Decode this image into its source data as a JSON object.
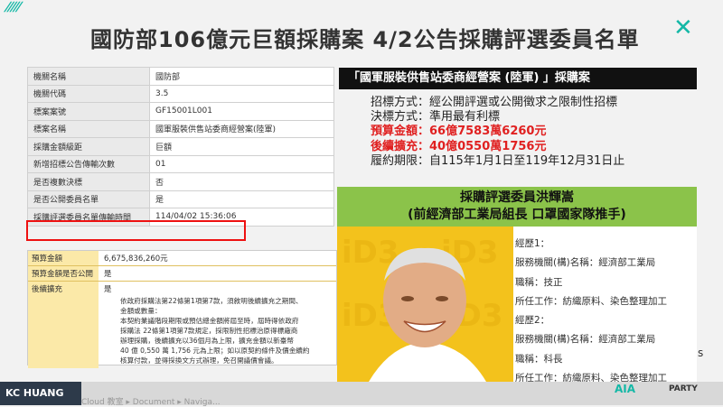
{
  "title": "國防部106億元巨額採購案  4/2公告採購評選委員名單",
  "left_table": [
    {
      "label": "機關名稱",
      "value": "國防部"
    },
    {
      "label": "機關代碼",
      "value": "3.5"
    },
    {
      "label": "標案案號",
      "value": "GF15001L001"
    },
    {
      "label": "標案名稱",
      "value": "國軍服裝供售站委商經營案(陸軍)"
    },
    {
      "label": "採購金額級距",
      "value": "巨額"
    },
    {
      "label": "新增招標公告傳輸次數",
      "value": "01"
    },
    {
      "label": "是否複數決標",
      "value": "否"
    },
    {
      "label": "是否公開委員名單",
      "value": "是"
    },
    {
      "label": "採購評選委員名單傳輸時間",
      "value": "114/04/02 15:36:06"
    }
  ],
  "budget": {
    "rows": [
      {
        "label": "預算金額",
        "value": "6,675,836,260元"
      },
      {
        "label": "預算金額是否公開",
        "value": "是"
      },
      {
        "label": "後續擴充",
        "value": "是"
      }
    ],
    "note": "依政府採購法第22條第1項第7款，須敘明後續擴充之期間、\n金額或數量：\n本契約業議階段期限或預估總金額將屆至時，屆時得依政府\n採購法 22條第1項第7款規定，採限制性招標治原得標廠商\n辦理採購，後續擴充以36個月為上限，擴充金額以新臺幣\n40 億 0,550 萬 1,756 元為上限；如以原契約條件及價金續約\n核算付款，並得採換文方式辦理，免召開議價會議。"
  },
  "right_header": "「國軍服裝供售站委商經營案 (陸軍) 」採購案",
  "info": {
    "method": "招標方式：經公開評選或公開徵求之限制性招標",
    "award": "決標方式：準用最有利標",
    "budget": "預算金額：66億7583萬6260元",
    "expansion": "後續擴充：40億0550萬1756元",
    "period": "履約期限：自115年1月1日至119年12月31日止"
  },
  "committee": {
    "line1": "採購評選委員洪輝嵩",
    "line2": "(前經濟部工業局組長 口罩國家隊推手)"
  },
  "experience": [
    "經歷1：",
    "服務機關(構)名稱：經濟部工業局",
    "職稱：技正",
    "所任工作：紡織原料、染色整理加工",
    "經歷2：",
    "服務機關(構)名稱：經濟部工業局",
    "職稱：科長",
    "所任工作：紡織原料、染色整理加工"
  ],
  "footer": {
    "brand": "KC HUANG",
    "party": "PARTY",
    "logo": "AIA",
    "taskbar": "Cloud 教室 ▸    Document ▸    Naviga..."
  },
  "colors": {
    "accent": "#14b8a6",
    "green_box": "#8bc34a",
    "photo_bg": "#f3c21c",
    "red": "#e02020"
  }
}
